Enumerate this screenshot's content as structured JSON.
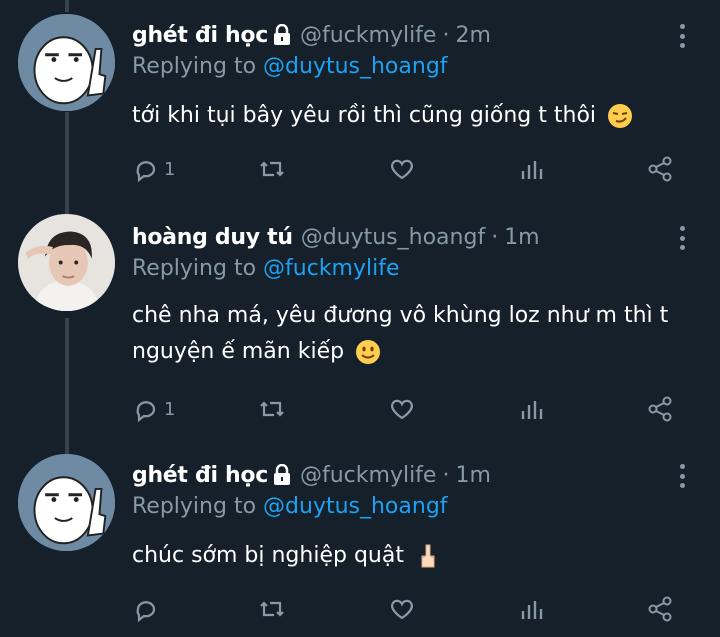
{
  "tweets": [
    {
      "name": "ghét đi học",
      "protected": true,
      "handle": "@fuckmylife",
      "separator": "·",
      "time": "2m",
      "replying_prefix": "Replying to",
      "replying_to": "@duytus_hoangf",
      "text_lines": [
        "tới khi tụi bây yêu rồi thì cũng giống t thôi"
      ],
      "emoji": "smirk-face",
      "reply_count": "1",
      "avatar": "meme-face-avatar"
    },
    {
      "name": "hoàng duy tú",
      "protected": false,
      "handle": "@duytus_hoangf",
      "separator": "·",
      "time": "1m",
      "replying_prefix": "Replying to",
      "replying_to": "@fuckmylife",
      "text_lines": [
        "chê nha má, yêu đương vô khùng loz như m thì t",
        "nguyện ế mãn kiếp"
      ],
      "emoji": "slightly-smiling-face",
      "reply_count": "1",
      "avatar": "photo-avatar"
    },
    {
      "name": "ghét đi học",
      "protected": true,
      "handle": "@fuckmylife",
      "separator": "·",
      "time": "1m",
      "replying_prefix": "Replying to",
      "replying_to": "@duytus_hoangf",
      "text_lines": [
        "chúc sớm bị nghiệp quật"
      ],
      "emoji": "middle-finger",
      "reply_count": "",
      "avatar": "meme-face-avatar"
    }
  ],
  "colors": {
    "background": "#15202b",
    "text": "#ffffff",
    "secondary": "#8899a6",
    "mention": "#1da1f2",
    "thread_line": "#38444d"
  }
}
